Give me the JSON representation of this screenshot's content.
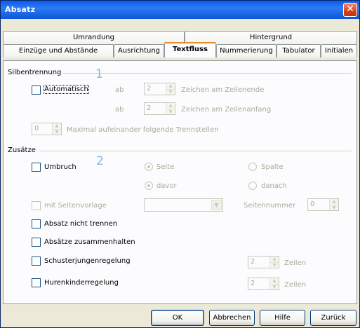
{
  "window": {
    "title": "Absatz",
    "close_glyph": "✕"
  },
  "tabs": {
    "row1": [
      "Umrandung",
      "Hintergrund"
    ],
    "row2": [
      "Einzüge und Abstände",
      "Ausrichtung",
      "Textfluss",
      "Nummerierung",
      "Tabulator",
      "Initialen"
    ],
    "active": "Textfluss"
  },
  "silbentrennung": {
    "heading": "Silbentrennung",
    "auto_label": "Automatisch",
    "auto_checked": false,
    "row_end_prefix": "ab",
    "row_end_value": "2",
    "row_end_label": "Zeichen am Zeilenende",
    "row_start_prefix": "ab",
    "row_start_value": "2",
    "row_start_label": "Zeichen am Zeilenanfang",
    "max_value": "0",
    "max_label": "Maximal aufeinander folgende Trennstellen",
    "marker": "1"
  },
  "zusaetze": {
    "heading": "Zusätze",
    "umbruch_label": "Umbruch",
    "umbruch_checked": false,
    "marker": "2",
    "radio_seite": "Seite",
    "radio_spalte": "Spalte",
    "radio_davor": "davor",
    "radio_danach": "danach",
    "seitenvorlage_label": "mit Seitenvorlage",
    "seitenvorlage_value": "",
    "seitennummer_label": "Seitennummer",
    "seitennummer_value": "0",
    "nicht_trennen_label": "Absatz nicht trennen",
    "zusammenhalten_label": "Absätze zusammenhalten",
    "schusterjungen_label": "Schusterjungenregelung",
    "schusterjungen_value": "2",
    "schusterjungen_unit": "Zeilen",
    "hurenkinder_label": "Hurenkinderregelung",
    "hurenkinder_value": "2",
    "hurenkinder_unit": "Zeilen"
  },
  "buttons": {
    "ok": "OK",
    "cancel": "Abbrechen",
    "help": "Hilfe",
    "back": "Zurück"
  },
  "icons": {
    "spin_up": "▲",
    "spin_down": "▼",
    "dropdown": "▼"
  },
  "colors": {
    "titlebar": "#0a5ce8",
    "close": "#d9411b",
    "marker": "#7ab8f5",
    "active_tab_accent": "#e68b2c"
  }
}
